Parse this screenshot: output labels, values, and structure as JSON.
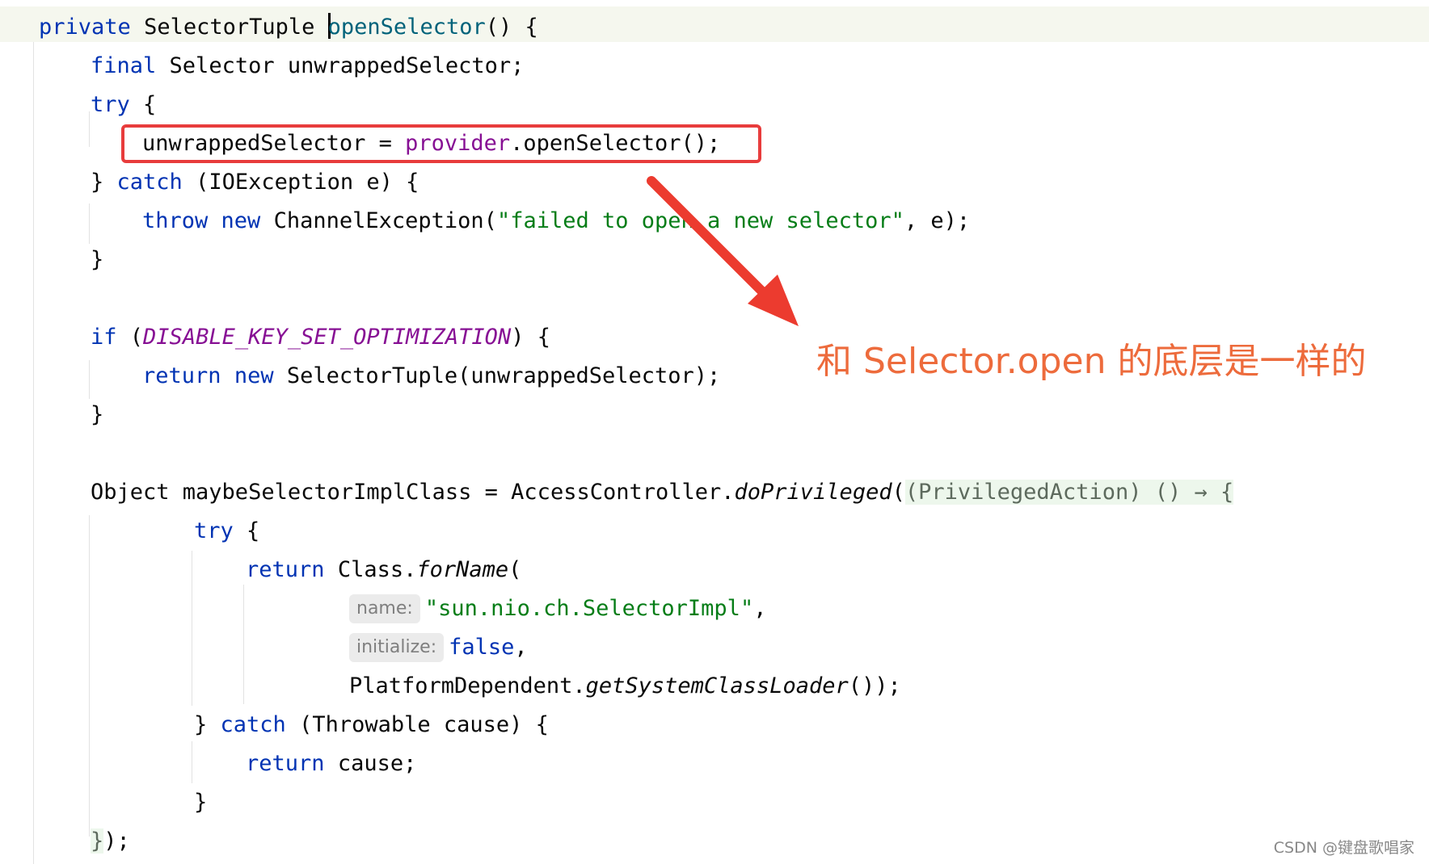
{
  "code": {
    "l1": {
      "kw": "private",
      "type": "SelectorTuple",
      "method": "openSelector",
      "rest": "() {"
    },
    "l2": {
      "kw": "final",
      "rest": "Selector unwrappedSelector;"
    },
    "l3": {
      "kw": "try",
      "rest": "{"
    },
    "l4": {
      "a": "unwrappedSelector = ",
      "field": "provider",
      "b": ".openSelector();"
    },
    "l5": {
      "a": "} ",
      "kw": "catch",
      "b": "(IOException e) {"
    },
    "l6": {
      "kw1": "throw",
      "kw2": "new",
      "a": "ChannelException(",
      "str": "\"failed to open a new selector\"",
      "b": ", e);"
    },
    "l7": {
      "a": "}"
    },
    "l8": {
      "kw": "if",
      "a": "(",
      "field": "DISABLE_KEY_SET_OPTIMIZATION",
      "b": ") {"
    },
    "l9": {
      "kw1": "return",
      "kw2": "new",
      "a": "SelectorTuple(unwrappedSelector);"
    },
    "l10": {
      "a": "}"
    },
    "l11": {
      "a": "Object maybeSelectorImplClass = AccessController.",
      "method": "doPrivileged",
      "b": "(",
      "lambda": "(PrivilegedAction) () → {"
    },
    "l12": {
      "kw": "try",
      "a": "{"
    },
    "l13": {
      "kw": "return",
      "a": "Class.",
      "method": "forName",
      "b": "("
    },
    "l14": {
      "hint": "name:",
      "str": "\"sun.nio.ch.SelectorImpl\"",
      "a": ","
    },
    "l15": {
      "hint": "initialize:",
      "kw": "false",
      "a": ","
    },
    "l16": {
      "a": "PlatformDependent.",
      "method": "getSystemClassLoader",
      "b": "());"
    },
    "l17": {
      "a": "} ",
      "kw": "catch",
      "b": "(Throwable cause) {"
    },
    "l18": {
      "kw": "return",
      "a": "cause;"
    },
    "l19": {
      "a": "}"
    },
    "l20": {
      "brace": "}",
      "a": ");"
    }
  },
  "annotation": {
    "text": "和 Selector.open 的底层是一样的"
  },
  "watermark": {
    "text": "CSDN @键盘歌唱家"
  },
  "colors": {
    "highlight_box": "#e83c3c",
    "arrow": "#ec3b2f",
    "annotation_text": "#ed6b3c"
  }
}
